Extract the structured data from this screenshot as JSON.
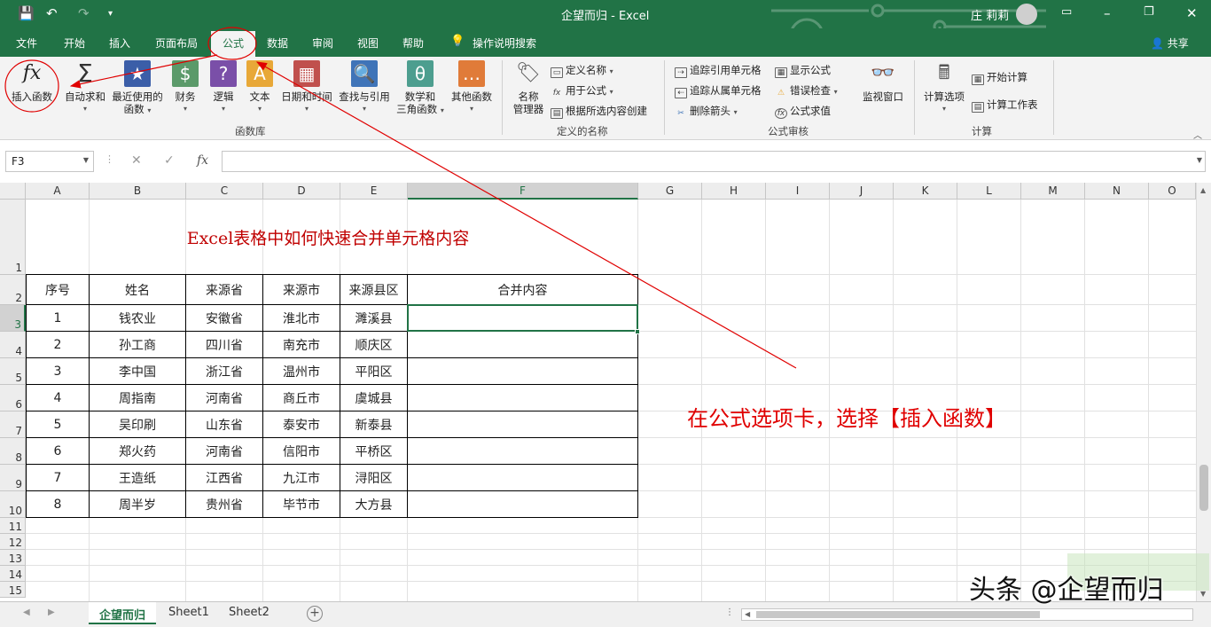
{
  "title": "企望而归 - Excel",
  "user": "庄 莉莉",
  "qat": {
    "save": "💾",
    "undo": "↶",
    "redo": "↷"
  },
  "tabs": [
    "文件",
    "开始",
    "插入",
    "页面布局",
    "公式",
    "数据",
    "审阅",
    "视图",
    "帮助"
  ],
  "active_tab": "公式",
  "tellme": "操作说明搜索",
  "share": "共享",
  "ribbon": {
    "groups": {
      "library": "函数库",
      "names": "定义的名称",
      "audit": "公式审核",
      "calc": "计算"
    },
    "big_buttons": {
      "insert_fn": "插入函数",
      "autosum": "自动求和",
      "recent_1": "最近使用的",
      "recent_2": "函数",
      "finance": "财务",
      "logic": "逻辑",
      "text": "文本",
      "datetime": "日期和时间",
      "lookup": "查找与引用",
      "math_1": "数学和",
      "math_2": "三角函数",
      "other": "其他函数",
      "name_mgr_1": "名称",
      "name_mgr_2": "管理器",
      "watch": "监视窗口",
      "calc_opt": "计算选项"
    },
    "small_buttons": {
      "define_name": "定义名称",
      "use_in_formula": "用于公式",
      "create_from_sel": "根据所选内容创建",
      "trace_prec": "追踪引用单元格",
      "trace_dep": "追踪从属单元格",
      "remove_arrows": "删除箭头",
      "show_formulas": "显示公式",
      "error_check": "错误检查",
      "eval_formula": "公式求值",
      "calc_now": "开始计算",
      "calc_sheet": "计算工作表"
    }
  },
  "namebox": "F3",
  "formula": "",
  "columns": [
    "A",
    "B",
    "C",
    "D",
    "E",
    "F",
    "G",
    "H",
    "I",
    "J",
    "K",
    "L",
    "M",
    "N",
    "O"
  ],
  "rows": [
    "1",
    "2",
    "3",
    "4",
    "5",
    "6",
    "7",
    "8",
    "9",
    "10",
    "11",
    "12",
    "13",
    "14",
    "15"
  ],
  "sheet_title": "Excel表格中如何快速合并单元格内容",
  "table": {
    "headers": [
      "序号",
      "姓名",
      "来源省",
      "来源市",
      "来源县区",
      "合并内容"
    ],
    "rows": [
      [
        "1",
        "钱农业",
        "安徽省",
        "淮北市",
        "濉溪县",
        ""
      ],
      [
        "2",
        "孙工商",
        "四川省",
        "南充市",
        "顺庆区",
        ""
      ],
      [
        "3",
        "李中国",
        "浙江省",
        "温州市",
        "平阳区",
        ""
      ],
      [
        "4",
        "周指南",
        "河南省",
        "商丘市",
        "虞城县",
        ""
      ],
      [
        "5",
        "吴印刷",
        "山东省",
        "泰安市",
        "新泰县",
        ""
      ],
      [
        "6",
        "郑火药",
        "河南省",
        "信阳市",
        "平桥区",
        ""
      ],
      [
        "7",
        "王造纸",
        "江西省",
        "九江市",
        "浔阳区",
        ""
      ],
      [
        "8",
        "周半岁",
        "贵州省",
        "毕节市",
        "大方县",
        ""
      ]
    ]
  },
  "annotation": "在公式选项卡，选择【插入函数】",
  "sheets": [
    "企望而归",
    "Sheet1",
    "Sheet2"
  ],
  "active_sheet": "企望而归",
  "watermark": "头条 @企望而归",
  "colors": {
    "excel_green": "#217346",
    "annotation_red": "#e00000",
    "title_red": "#c00000"
  }
}
